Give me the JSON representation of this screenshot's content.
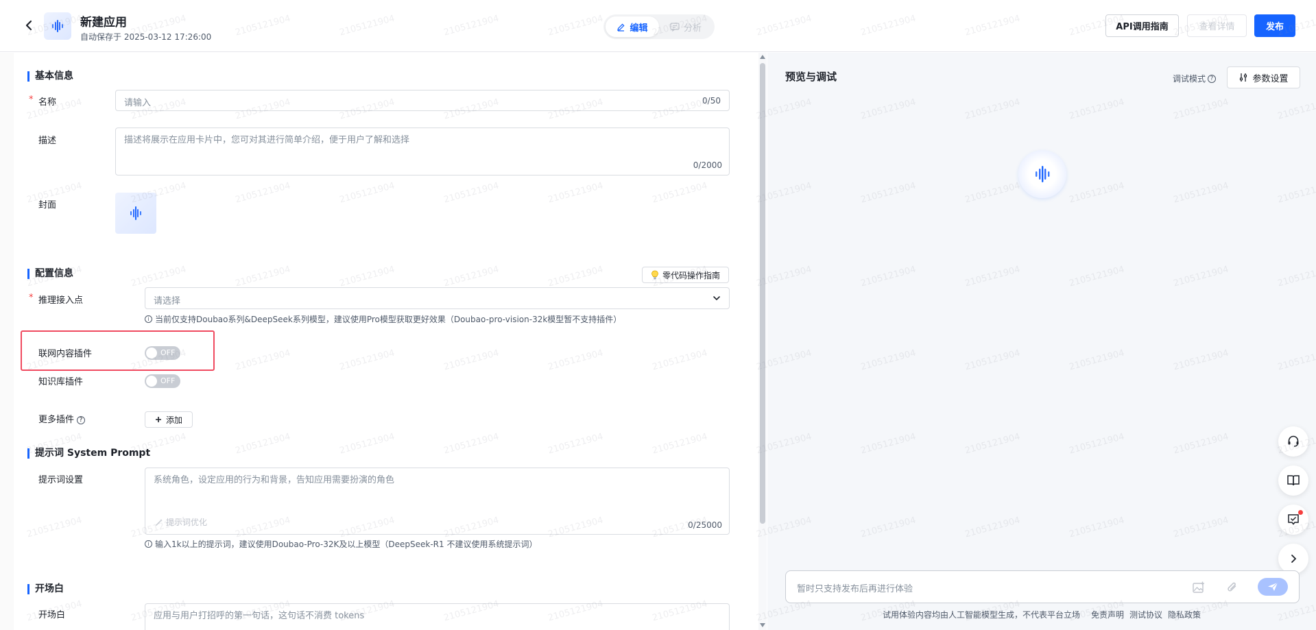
{
  "header": {
    "title": "新建应用",
    "autosave": "自动保存于 2025-03-12 17:26:00",
    "tabs": [
      {
        "label": "编辑",
        "active": true
      },
      {
        "label": "分析",
        "active": false
      }
    ],
    "api_guide_label": "API调用指南",
    "view_detail_label": "查看详情",
    "publish_label": "发布"
  },
  "basic": {
    "section_title": "基本信息",
    "name_label": "名称",
    "name_placeholder": "请输入",
    "name_count": "0/50",
    "desc_label": "描述",
    "desc_placeholder": "描述将展示在应用卡片中，您可对其进行简单介绍，便于用户了解和选择",
    "desc_count": "0/2000",
    "cover_label": "封面"
  },
  "config": {
    "section_title": "配置信息",
    "guide_label": "零代码操作指南",
    "endpoint_label": "推理接入点",
    "endpoint_placeholder": "请选择",
    "endpoint_hint": "当前仅支持Doubao系列&DeepSeek系列模型，建议使用Pro模型获取更好效果（Doubao-pro-vision-32k模型暂不支持插件）",
    "web_plugin_label": "联网内容插件",
    "kb_plugin_label": "知识库插件",
    "toggle_off": "OFF",
    "more_plugins_label": "更多插件",
    "add_label": "添加"
  },
  "prompt": {
    "section_title": "提示词 System Prompt",
    "label": "提示词设置",
    "placeholder": "系统角色，设定应用的行为和背景，告知应用需要扮演的角色",
    "optimize_label": "提示词优化",
    "count": "0/25000",
    "hint": "输入1k以上的提示词，建议使用Doubao-Pro-32K及以上模型（DeepSeek-R1 不建议使用系统提示词）"
  },
  "opening": {
    "section_title": "开场白",
    "label": "开场白",
    "placeholder": "应用与用户打招呼的第一句话，这句话不消费 tokens"
  },
  "preview": {
    "title": "预览与调试",
    "debug_mode": "调试模式",
    "param_settings": "参数设置",
    "chat_placeholder": "暂时只支持发布后再进行体验",
    "footer_note": "试用体验内容均由人工智能模型生成，不代表平台立场",
    "footer_links": [
      "免责声明",
      "测试协议",
      "隐私政策"
    ]
  },
  "watermark": "2105121904",
  "colors": {
    "primary": "#1664ff",
    "highlight": "#f04a5f",
    "required": "#f53f3f"
  }
}
